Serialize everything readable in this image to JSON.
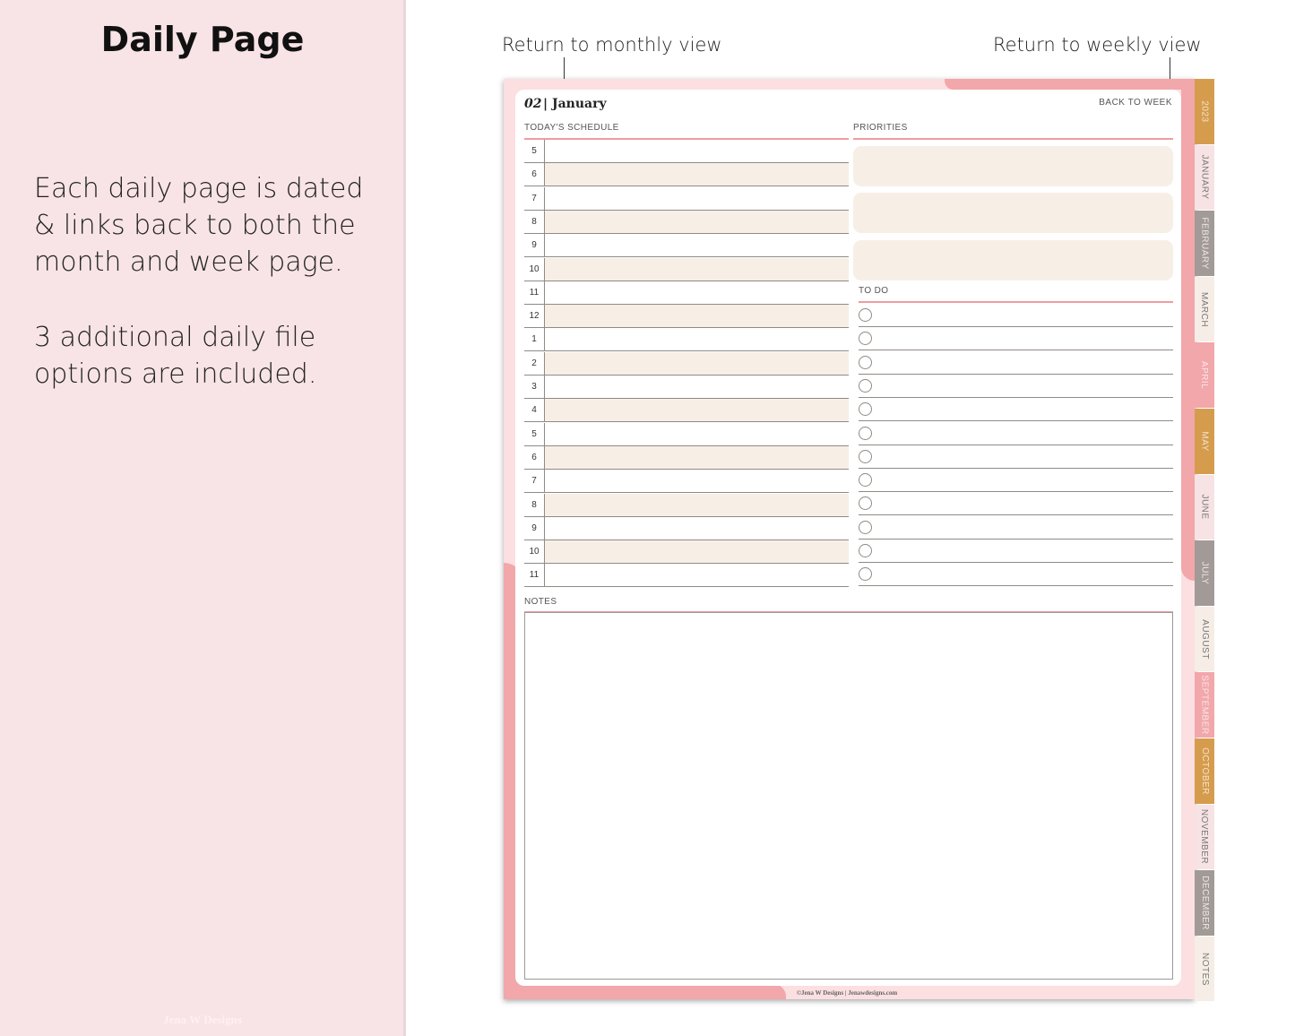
{
  "left_panel": {
    "title": "Daily Page",
    "paragraph1": "Each daily page is dated & links back to both the month and week page.",
    "paragraph2": "3 additional daily file options are included.",
    "watermark": "Jena W Designs"
  },
  "annotations": {
    "monthly": "Return to monthly view",
    "weekly": "Return to weekly view"
  },
  "page": {
    "date_number": "02",
    "date_month": "| January",
    "back_to_week": "BACK TO WEEK",
    "schedule_label": "TODAY'S SCHEDULE",
    "priorities_label": "PRIORITIES",
    "todo_label": "TO DO",
    "notes_label": "NOTES",
    "hours": [
      "5",
      "6",
      "7",
      "8",
      "9",
      "10",
      "11",
      "12",
      "1",
      "2",
      "3",
      "4",
      "5",
      "6",
      "7",
      "8",
      "9",
      "10",
      "11"
    ],
    "footer": "©Jena W Designs | Jenawdesigns.com"
  },
  "tabs": [
    {
      "label": "2023",
      "color": "#d69c4d",
      "text_color": "#f3e3cc"
    },
    {
      "label": "JANUARY",
      "color": "#f7e3e4",
      "text_color": "#777777"
    },
    {
      "label": "FEBRUARY",
      "color": "#a29a96",
      "text_color": "#ece8e6"
    },
    {
      "label": "MARCH",
      "color": "#f6eee6",
      "text_color": "#777777"
    },
    {
      "label": "APRIL",
      "color": "#f2a7ab",
      "text_color": "#f8e6e7"
    },
    {
      "label": "MAY",
      "color": "#d69c4d",
      "text_color": "#f3e3cc"
    },
    {
      "label": "JUNE",
      "color": "#f7e3e4",
      "text_color": "#777777"
    },
    {
      "label": "JULY",
      "color": "#a29a96",
      "text_color": "#ece8e6"
    },
    {
      "label": "AUGUST",
      "color": "#f6eee6",
      "text_color": "#777777"
    },
    {
      "label": "SEPTEMBER",
      "color": "#f2a7ab",
      "text_color": "#f8e6e7"
    },
    {
      "label": "OCTOBER",
      "color": "#d69c4d",
      "text_color": "#f3e3cc"
    },
    {
      "label": "NOVEMBER",
      "color": "#f7e3e4",
      "text_color": "#777777"
    },
    {
      "label": "DECEMBER",
      "color": "#a29a96",
      "text_color": "#ece8e6"
    },
    {
      "label": "NOTES",
      "color": "#f6eee6",
      "text_color": "#777777"
    }
  ],
  "colors": {
    "accent_pink": "#ef9ca0",
    "cream": "#f7efe6",
    "panel_bg": "#f8e4e6"
  }
}
